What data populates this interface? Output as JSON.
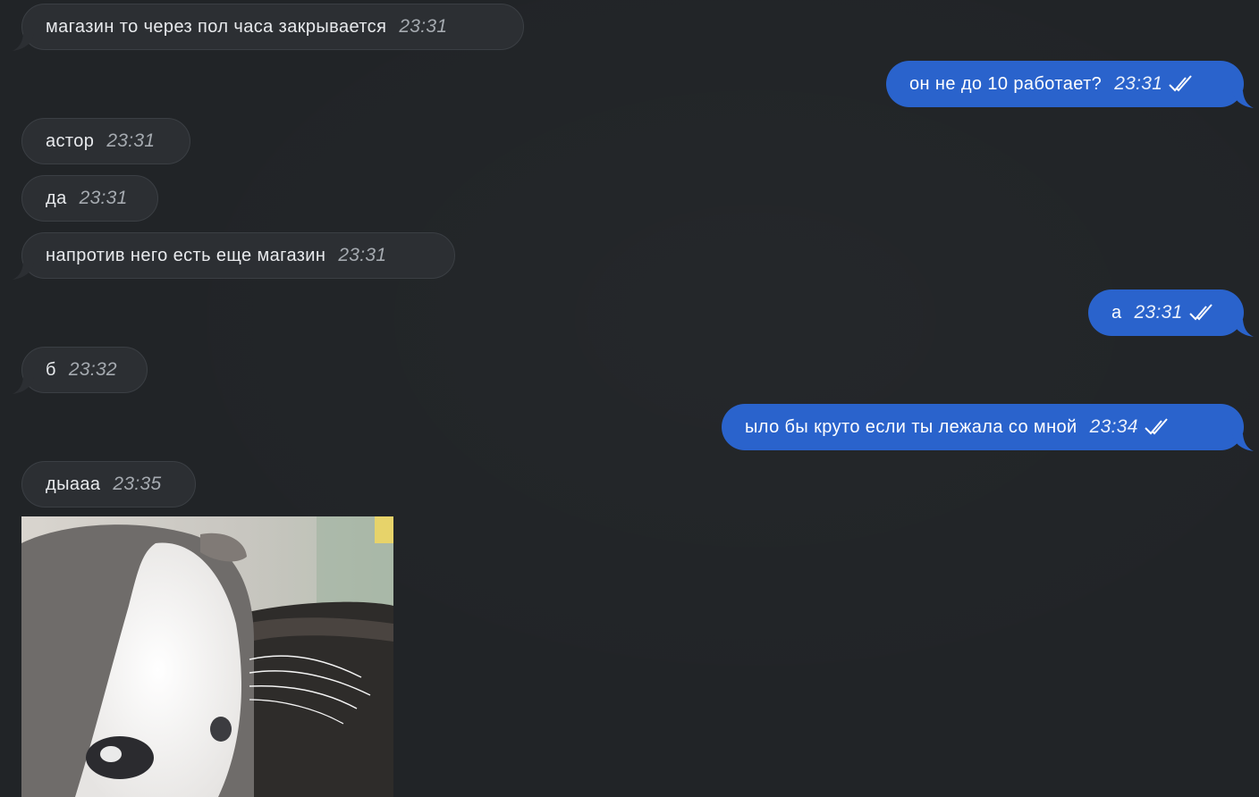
{
  "messages": [
    {
      "direction": "in",
      "text": "магазин то через пол часа закрывается",
      "time": "23:31"
    },
    {
      "direction": "out",
      "text": "он не до 10 работает?",
      "time": "23:31",
      "status": "read-double-check-icon"
    },
    {
      "direction": "in",
      "text": "астор",
      "time": "23:31"
    },
    {
      "direction": "in",
      "text": "да",
      "time": "23:31"
    },
    {
      "direction": "in",
      "text": "напротив него есть еще магазин",
      "time": "23:31"
    },
    {
      "direction": "out",
      "text": "а",
      "time": "23:31",
      "status": "read-double-check-icon"
    },
    {
      "direction": "in",
      "text": "б",
      "time": "23:32"
    },
    {
      "direction": "out",
      "text": "ыло бы круто если ты лежала со мной",
      "time": "23:34",
      "status": "read-double-check-icon"
    },
    {
      "direction": "in",
      "text": "дыааа",
      "time": "23:35"
    }
  ],
  "media": {
    "icon": "cat-gif-image"
  },
  "colors": {
    "background": "#212427",
    "incoming_bubble": "#2c2f33",
    "outgoing_bubble": "#2a63cc",
    "incoming_time": "#a5aab0"
  }
}
